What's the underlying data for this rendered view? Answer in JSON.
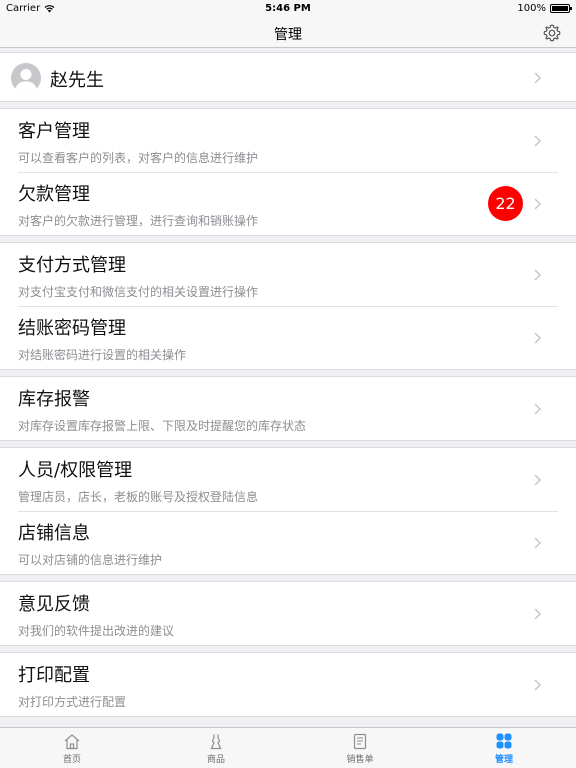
{
  "status_bar": {
    "carrier": "Carrier",
    "time": "5:46 PM",
    "battery": "100%"
  },
  "nav": {
    "title": "管理",
    "settings_icon": "gear-icon"
  },
  "profile": {
    "name": "赵先生"
  },
  "groups": [
    {
      "items": [
        {
          "title": "客户管理",
          "description": "可以查看客户的列表，对客户的信息进行维护"
        },
        {
          "title": "欠款管理",
          "description": "对客户的欠款进行管理，进行查询和销账操作",
          "badge": "22"
        }
      ]
    },
    {
      "items": [
        {
          "title": "支付方式管理",
          "description": "对支付宝支付和微信支付的相关设置进行操作"
        },
        {
          "title": "结账密码管理",
          "description": "对结账密码进行设置的相关操作"
        }
      ]
    },
    {
      "items": [
        {
          "title": "库存报警",
          "description": "对库存设置库存报警上限、下限及时提醒您的库存状态"
        }
      ]
    },
    {
      "items": [
        {
          "title": "人员/权限管理",
          "description": "管理店员，店长，老板的账号及授权登陆信息"
        },
        {
          "title": "店铺信息",
          "description": "可以对店铺的信息进行维护"
        }
      ]
    },
    {
      "items": [
        {
          "title": "意见反馈",
          "description": "对我们的软件提出改进的建议"
        }
      ]
    },
    {
      "items": [
        {
          "title": "打印配置",
          "description": "对打印方式进行配置"
        }
      ]
    }
  ],
  "tab_bar": {
    "tabs": [
      {
        "label": "首页",
        "icon": "home-icon"
      },
      {
        "label": "商品",
        "icon": "dress-icon"
      },
      {
        "label": "销售单",
        "icon": "document-icon"
      },
      {
        "label": "管理",
        "icon": "grid-icon",
        "active": true
      }
    ]
  },
  "colors": {
    "badge": "#ff0000",
    "active_tab": "#1e90ff",
    "background": "#efeff4"
  }
}
